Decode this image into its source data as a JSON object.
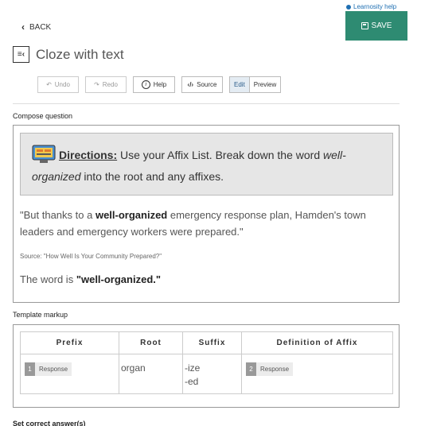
{
  "header": {
    "help_link": "Learnosity help",
    "save_label": "SAVE",
    "back_label": "BACK",
    "title": "Cloze with text",
    "title_icon": "cloze-icon"
  },
  "toolbar": {
    "undo": "Undo",
    "redo": "Redo",
    "help": "Help",
    "source": "Source",
    "edit": "Edit",
    "preview": "Preview"
  },
  "compose": {
    "label": "Compose question",
    "directions_word": "Directions:",
    "directions_text": " Use your Affix List. Break down the word ",
    "directions_em": "well-organized",
    "directions_tail": " into the root and any affixes.",
    "quote_start": "\"But thanks to a ",
    "quote_bold": "well-organized",
    "quote_end": " emergency response plan, Hamden's town leaders and emergency workers were prepared.\"",
    "source": "Source: \"How Well Is Your Community Prepared?\"",
    "word_prefix": "The word is ",
    "word_bold": "\"well-organized.\""
  },
  "template": {
    "label": "Template markup",
    "headers": [
      "Prefix",
      "Root",
      "Suffix",
      "Definition of Affix"
    ],
    "response1_num": "1",
    "response1_label": "Response",
    "root_value": "organ",
    "suffix_line1": "-ize",
    "suffix_line2": "-ed",
    "response2_num": "2",
    "response2_label": "Response"
  },
  "answer": {
    "label": "Set correct answer(s)"
  },
  "colors": {
    "save_bg": "#2e8b72",
    "link": "#1f6fb2",
    "active_tab_bg": "#e4ecf3"
  }
}
